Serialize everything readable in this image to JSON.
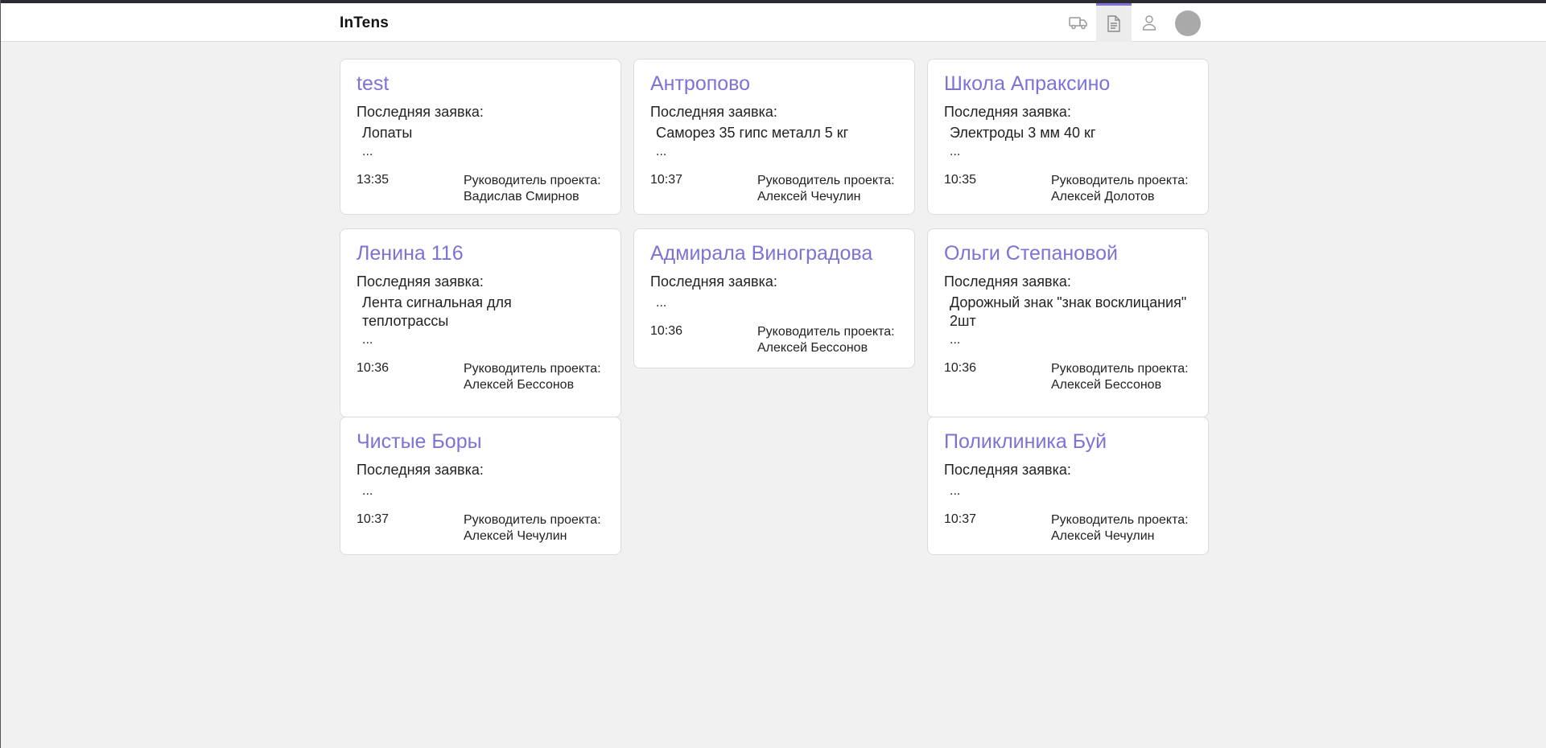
{
  "app": {
    "brand": "InTens"
  },
  "header": {
    "icons": [
      "truck-icon",
      "document-icon",
      "user-icon"
    ],
    "active_icon": "document-icon"
  },
  "colors": {
    "accent": "#7b73d8",
    "background": "#f1f1f1",
    "card": "#ffffff",
    "avatar": "#a9a9a9"
  },
  "cards": [
    {
      "title": "test",
      "label": "Последняя заявка:",
      "items": [
        "Лопаты"
      ],
      "ellipsis": "...",
      "time": "13:35",
      "manager_label": "Руководитель проекта:",
      "manager": "Вадислав Смирнов"
    },
    {
      "title": "Антропово",
      "label": "Последняя заявка:",
      "items": [
        "Саморез 35 гипс металл 5 кг"
      ],
      "ellipsis": "...",
      "time": "10:37",
      "manager_label": "Руководитель проекта:",
      "manager": "Алексей Чечулин"
    },
    {
      "title": "Школа Апраксино",
      "label": "Последняя заявка:",
      "items": [
        "Электроды 3 мм 40 кг"
      ],
      "ellipsis": "...",
      "time": "10:35",
      "manager_label": "Руководитель проекта:",
      "manager": "Алексей Долотов"
    },
    {
      "title": "Ленина 116",
      "label": "Последняя заявка:",
      "items": [
        "Лента сигнальная для",
        "теплотрассы"
      ],
      "ellipsis": "...",
      "time": "10:36",
      "manager_label": "Руководитель проекта:",
      "manager": "Алексей Бессонов"
    },
    {
      "title": "Адмирала Виноградова",
      "label": "Последняя заявка:",
      "items": [],
      "ellipsis": "...",
      "time": "10:36",
      "manager_label": "Руководитель проекта:",
      "manager": "Алексей Бессонов"
    },
    {
      "title": "Ольги Степановой",
      "label": "Последняя заявка:",
      "items": [
        "Дорожный знак \"знак восклицания\"",
        "2шт"
      ],
      "ellipsis": "...",
      "time": "10:36",
      "manager_label": "Руководитель проекта:",
      "manager": "Алексей Бессонов"
    },
    {
      "title": "Чистые Боры",
      "label": "Последняя заявка:",
      "items": [],
      "ellipsis": "...",
      "time": "10:37",
      "manager_label": "Руководитель проекта:",
      "manager": "Алексей Чечулин"
    },
    {
      "title": "Поликлиника Буй",
      "label": "Последняя заявка:",
      "items": [],
      "ellipsis": "...",
      "time": "10:37",
      "manager_label": "Руководитель проекта:",
      "manager": "Алексей Чечулин"
    }
  ]
}
